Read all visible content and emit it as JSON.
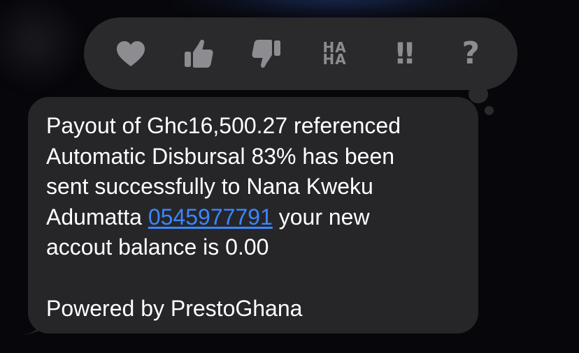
{
  "tapback": {
    "reactions": [
      {
        "name": "heart",
        "icon": "heart-icon"
      },
      {
        "name": "thumbs-up",
        "icon": "thumbs-up-icon"
      },
      {
        "name": "thumbs-down",
        "icon": "thumbs-down-icon"
      },
      {
        "name": "haha",
        "icon": "haha-icon",
        "line1": "HA",
        "line2": "HA"
      },
      {
        "name": "emphasize",
        "icon": "double-exclamation-icon",
        "glyph": "!!"
      },
      {
        "name": "question",
        "icon": "question-icon",
        "glyph": "?"
      }
    ]
  },
  "message": {
    "line1": "Payout of Ghc16,500.27 referenced",
    "line2": "Automatic Disbursal 83% has been",
    "line3": "sent successfully to Nana Kweku",
    "line4_before": "Adumatta ",
    "phone_link": "0545977791",
    "line4_after": " your new",
    "line5": "accout balance is 0.00",
    "footer": "Powered by PrestoGhana"
  },
  "colors": {
    "background": "#07070b",
    "bubble": "#262629",
    "tapback_bar": "#2a2a2d",
    "icon": "#8c8c91",
    "text": "#ffffff",
    "link": "#3b87ff"
  }
}
